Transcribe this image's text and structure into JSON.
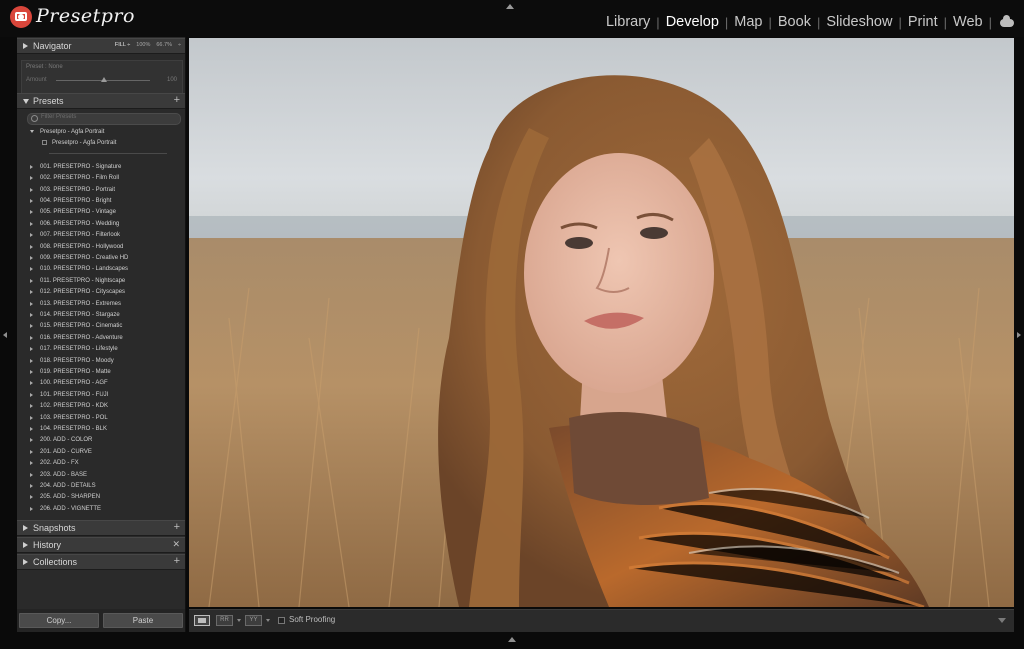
{
  "app": {
    "brand": "Presetpro"
  },
  "modules": [
    {
      "label": "Library",
      "active": false
    },
    {
      "label": "Develop",
      "active": true
    },
    {
      "label": "Map",
      "active": false
    },
    {
      "label": "Book",
      "active": false
    },
    {
      "label": "Slideshow",
      "active": false
    },
    {
      "label": "Print",
      "active": false
    },
    {
      "label": "Web",
      "active": false
    }
  ],
  "navigator": {
    "title": "Navigator",
    "zoom_options": [
      "FILL ÷",
      "100%",
      "66.7%",
      "÷"
    ],
    "active_zoom": "FILL ÷",
    "preset_label": "Preset : None",
    "amount_label": "Amount",
    "amount_value": "100"
  },
  "presets": {
    "title": "Presets",
    "filter_placeholder": "Filter Presets",
    "open_folder": "Presetpro - Agfa Portrait",
    "open_item": "Presetpro - Agfa Portrait",
    "folders": [
      "001. PRESETPRO - Signature",
      "002. PRESETPRO - Film Roll",
      "003. PRESETPRO - Portrait",
      "004. PRESETPRO - Bright",
      "005. PRESETPRO - Vintage",
      "006. PRESETPRO - Wedding",
      "007. PRESETPRO - Filterlook",
      "008. PRESETPRO - Hollywood",
      "009. PRESETPRO - Creative HD",
      "010. PRESETPRO - Landscapes",
      "011. PRESETPRO - Nightscape",
      "012. PRESETPRO - Cityscapes",
      "013. PRESETPRO - Extremes",
      "014. PRESETPRO - Stargaze",
      "015. PRESETPRO - Cinematic",
      "016. PRESETPRO - Adventure",
      "017. PRESETPRO - Lifestyle",
      "018. PRESETPRO - Moody",
      "019. PRESETPRO - Matte",
      "100. PRESETPRO - AGF",
      "101. PRESETPRO - FUJI",
      "102. PRESETPRO - KDK",
      "103. PRESETPRO - POL",
      "104. PRESETPRO - BLK",
      "200. ADD - COLOR",
      "201. ADD - CURVE",
      "202. ADD - FX",
      "203. ADD - BASE",
      "204. ADD - DETAILS",
      "205. ADD - SHARPEN",
      "206. ADD - VIGNETTE"
    ]
  },
  "snapshots": {
    "title": "Snapshots"
  },
  "history": {
    "title": "History"
  },
  "collections": {
    "title": "Collections"
  },
  "buttons": {
    "copy": "Copy...",
    "paste": "Paste"
  },
  "toolbar": {
    "before_after": "RR",
    "yy": "YY",
    "soft_proofing": "Soft Proofing"
  },
  "icons": {
    "logo": "camera-icon",
    "cloud": "cloud-icon",
    "search": "search-icon"
  },
  "colors": {
    "brand": "#d9463b",
    "panel": "#2a2a2a",
    "background": "#0a0a0a"
  }
}
